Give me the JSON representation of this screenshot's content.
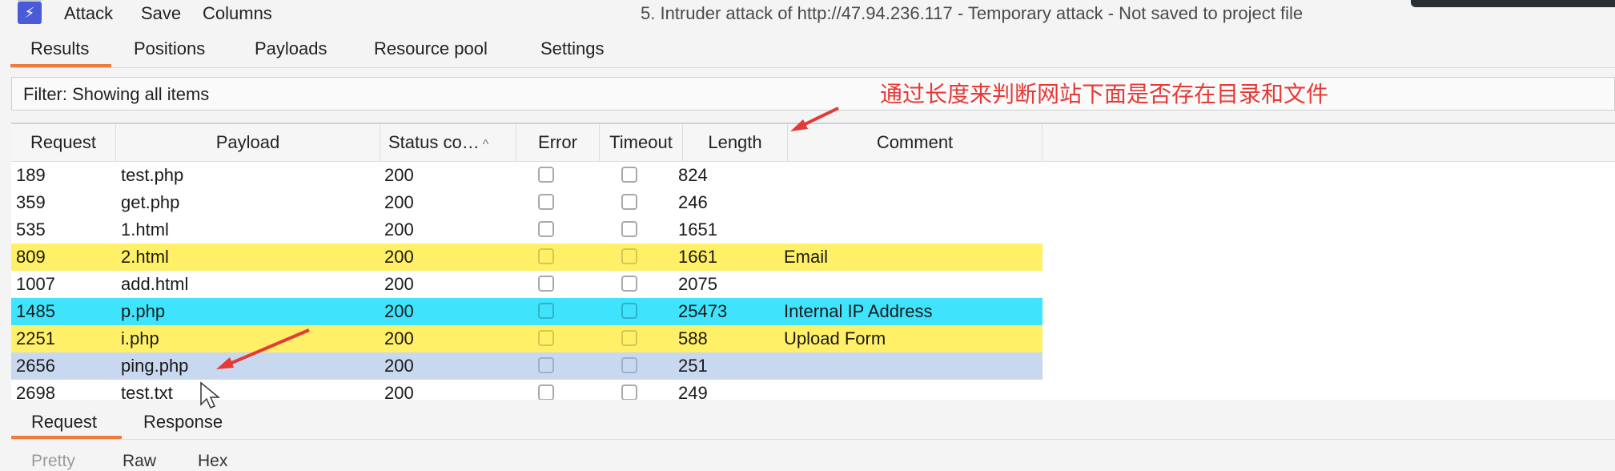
{
  "menu": {
    "attack": "Attack",
    "save": "Save",
    "columns": "Columns"
  },
  "window_title": "5. Intruder attack of http://47.94.236.117 - Temporary attack - Not saved to project file",
  "tabs": [
    "Results",
    "Positions",
    "Payloads",
    "Resource pool",
    "Settings"
  ],
  "filter_text": "Filter: Showing all items",
  "annotation": "通过长度来判断网站下面是否存在目录和文件",
  "columns": [
    "Request",
    "Payload",
    "Status co…",
    "Error",
    "Timeout",
    "Length",
    "Comment"
  ],
  "rows": [
    {
      "request": "189",
      "payload": "test.php",
      "status": "200",
      "length": "824",
      "comment": ""
    },
    {
      "request": "359",
      "payload": "get.php",
      "status": "200",
      "length": "246",
      "comment": ""
    },
    {
      "request": "535",
      "payload": "1.html",
      "status": "200",
      "length": "1651",
      "comment": ""
    },
    {
      "request": "809",
      "payload": "2.html",
      "status": "200",
      "length": "1661",
      "comment": "Email"
    },
    {
      "request": "1007",
      "payload": "add.html",
      "status": "200",
      "length": "2075",
      "comment": ""
    },
    {
      "request": "1485",
      "payload": "p.php",
      "status": "200",
      "length": "25473",
      "comment": "Internal IP Address"
    },
    {
      "request": "2251",
      "payload": "i.php",
      "status": "200",
      "length": "588",
      "comment": "Upload Form"
    },
    {
      "request": "2656",
      "payload": "ping.php",
      "status": "200",
      "length": "251",
      "comment": ""
    },
    {
      "request": "2698",
      "payload": "test.txt",
      "status": "200",
      "length": "249",
      "comment": ""
    }
  ],
  "bottom_tabs": [
    "Request",
    "Response"
  ],
  "sub_tabs": [
    "Pretty",
    "Raw",
    "Hex"
  ],
  "colors": {
    "accent": "#f07b3a",
    "highlight_yellow": "#fff067",
    "highlight_cyan": "#3fe3fb",
    "selected": "#c8d8ef",
    "annotation": "#e53a36"
  }
}
